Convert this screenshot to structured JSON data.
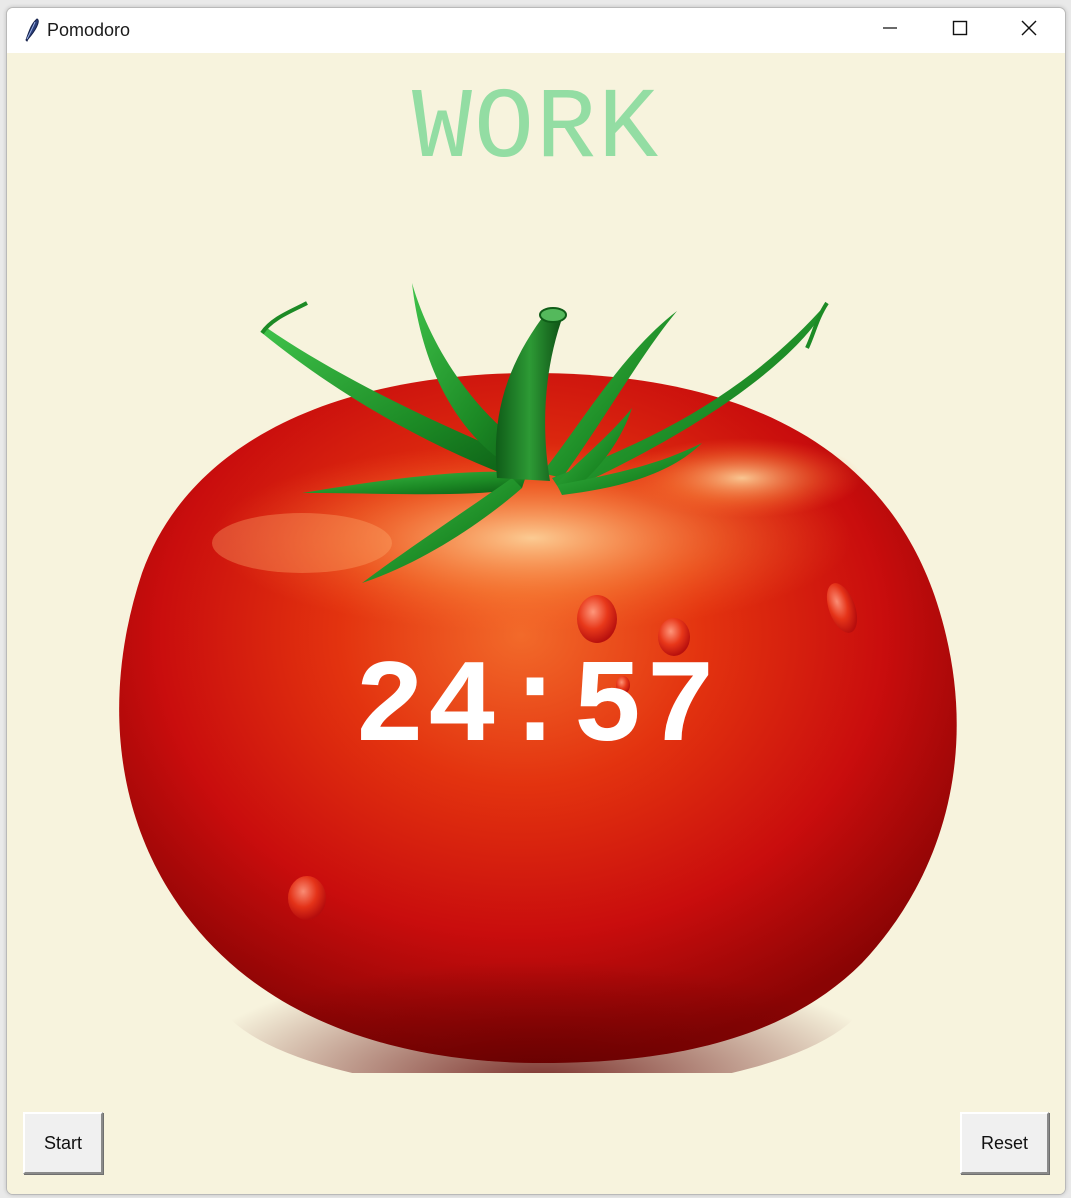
{
  "window": {
    "title": "Pomodoro",
    "app_icon": "feather-icon",
    "controls": {
      "minimize": "minimize-icon",
      "maximize": "maximize-icon",
      "close": "close-icon"
    }
  },
  "main": {
    "mode_label": "WORK",
    "timer_text": "24:57",
    "image": "tomato-image"
  },
  "buttons": {
    "start_label": "Start",
    "reset_label": "Reset"
  },
  "colors": {
    "background": "#f7f3dd",
    "mode_label": "#93dda3",
    "timer_text": "#ffffff",
    "tomato": "#d8220f",
    "leaves": "#1f8a2a"
  }
}
